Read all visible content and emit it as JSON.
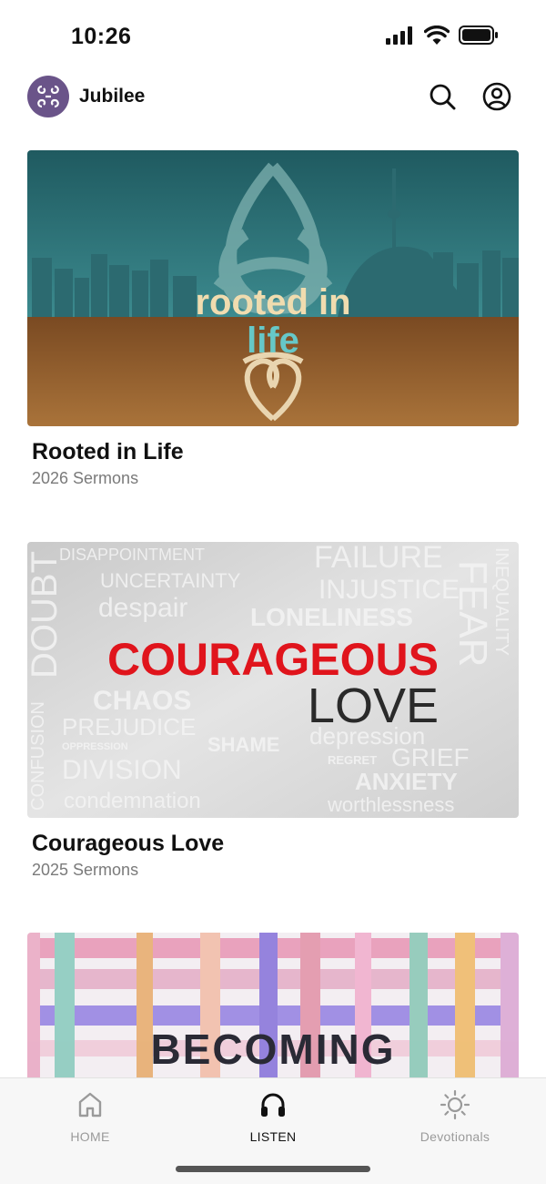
{
  "status_bar": {
    "time": "10:26"
  },
  "header": {
    "app_name": "Jubilee"
  },
  "series": [
    {
      "title": "Rooted in Life",
      "subtitle": "2026 Sermons",
      "art_line1": "rooted in",
      "art_line2": "life"
    },
    {
      "title": "Courageous Love",
      "subtitle": "2025 Sermons",
      "art_title": "COURAGEOUS",
      "art_subtitle": "LOVE",
      "art_words": [
        "DISAPPOINTMENT",
        "FAILURE",
        "INJUSTICE",
        "UNCERTAINTY",
        "despair",
        "LONELINESS",
        "DOUBT",
        "CHAOS",
        "FEAR",
        "PREJUDICE",
        "SHAME",
        "depression",
        "DIVISION",
        "GRIEF",
        "ANXIETY",
        "condemnation",
        "worthlessness",
        "CONFUSION",
        "INEQUALITY",
        "OPPRESSION",
        "REGRET"
      ]
    },
    {
      "art_title": "BECOMING"
    }
  ],
  "tabs": [
    {
      "label": "HOME",
      "icon": "home-icon",
      "active": false
    },
    {
      "label": "LISTEN",
      "icon": "headphones-icon",
      "active": true
    },
    {
      "label": "Devotionals",
      "icon": "sun-icon",
      "active": false
    }
  ],
  "colors": {
    "brand": "#6a5489",
    "courageous_red": "#e0141c",
    "rooted_teal": "#2a6a70",
    "rooted_soil": "#8a5a2c"
  }
}
